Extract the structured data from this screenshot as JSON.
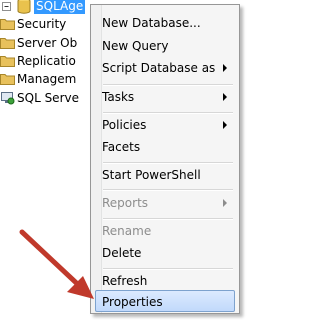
{
  "tree": {
    "root_label": "SQLAge",
    "items": [
      {
        "label": "Security",
        "icon": "folder-icon"
      },
      {
        "label": "Server Ob",
        "icon": "folder-icon"
      },
      {
        "label": "Replicatio",
        "icon": "folder-icon"
      },
      {
        "label": "Managem",
        "icon": "folder-icon"
      },
      {
        "label": "SQL Serve",
        "icon": "sql-agent-icon"
      }
    ]
  },
  "context_menu": {
    "items": [
      {
        "label": "New Database...",
        "has_submenu": false,
        "disabled": false
      },
      {
        "label": "New Query",
        "has_submenu": false,
        "disabled": false
      },
      {
        "label": "Script Database as",
        "has_submenu": true,
        "disabled": false
      },
      {
        "label": "Tasks",
        "has_submenu": true,
        "disabled": false
      },
      {
        "label": "Policies",
        "has_submenu": true,
        "disabled": false
      },
      {
        "label": "Facets",
        "has_submenu": false,
        "disabled": false
      },
      {
        "label": "Start PowerShell",
        "has_submenu": false,
        "disabled": false
      },
      {
        "label": "Reports",
        "has_submenu": true,
        "disabled": true
      },
      {
        "label": "Rename",
        "has_submenu": false,
        "disabled": true
      },
      {
        "label": "Delete",
        "has_submenu": false,
        "disabled": false
      },
      {
        "label": "Refresh",
        "has_submenu": false,
        "disabled": false
      },
      {
        "label": "Properties",
        "has_submenu": false,
        "disabled": false,
        "highlighted": true
      }
    ]
  },
  "colors": {
    "selection": "#3399ff",
    "menu_background": "#f5f5f5",
    "highlight_border": "#7da2ce",
    "annotation_arrow": "#c0392b",
    "disabled_text": "#8d8d8d",
    "folder": "#e8c15c"
  }
}
